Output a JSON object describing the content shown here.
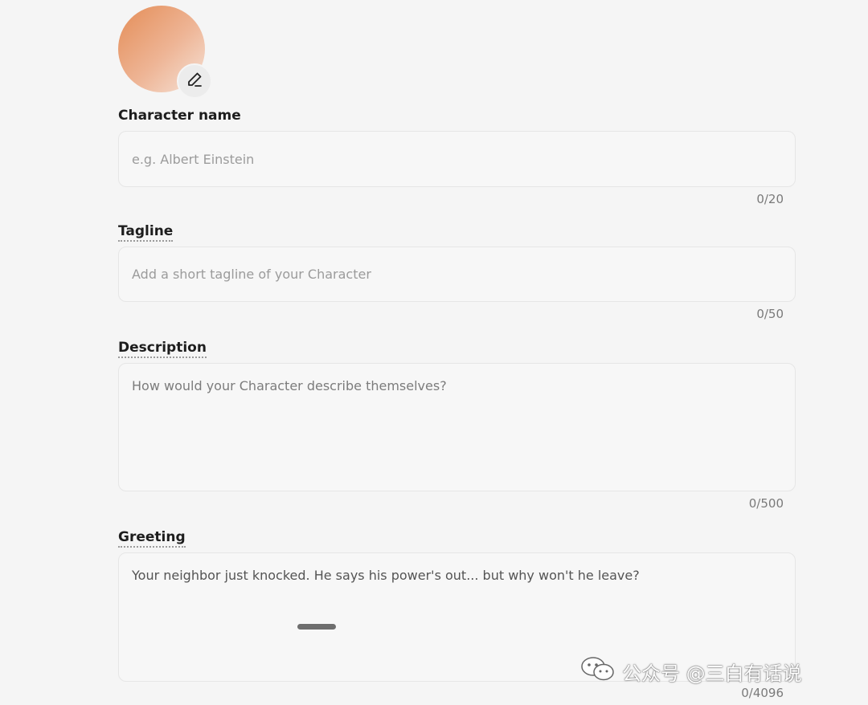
{
  "fields": {
    "name": {
      "label": "Character name",
      "placeholder": "e.g. Albert Einstein",
      "counter": "0/20"
    },
    "tagline": {
      "label": "Tagline",
      "placeholder": "Add a short tagline of your Character",
      "counter": "0/50"
    },
    "description": {
      "label": "Description",
      "placeholder": "How would your Character describe themselves?",
      "counter": "0/500"
    },
    "greeting": {
      "label": "Greeting",
      "value": "Your neighbor just knocked. He says his power's out... but why won't he leave?",
      "counter": "0/4096"
    }
  },
  "avatar": {
    "icon": "pencil-icon"
  },
  "watermark": {
    "text": "公众号 @三白有话说",
    "icon": "wechat-icon"
  }
}
